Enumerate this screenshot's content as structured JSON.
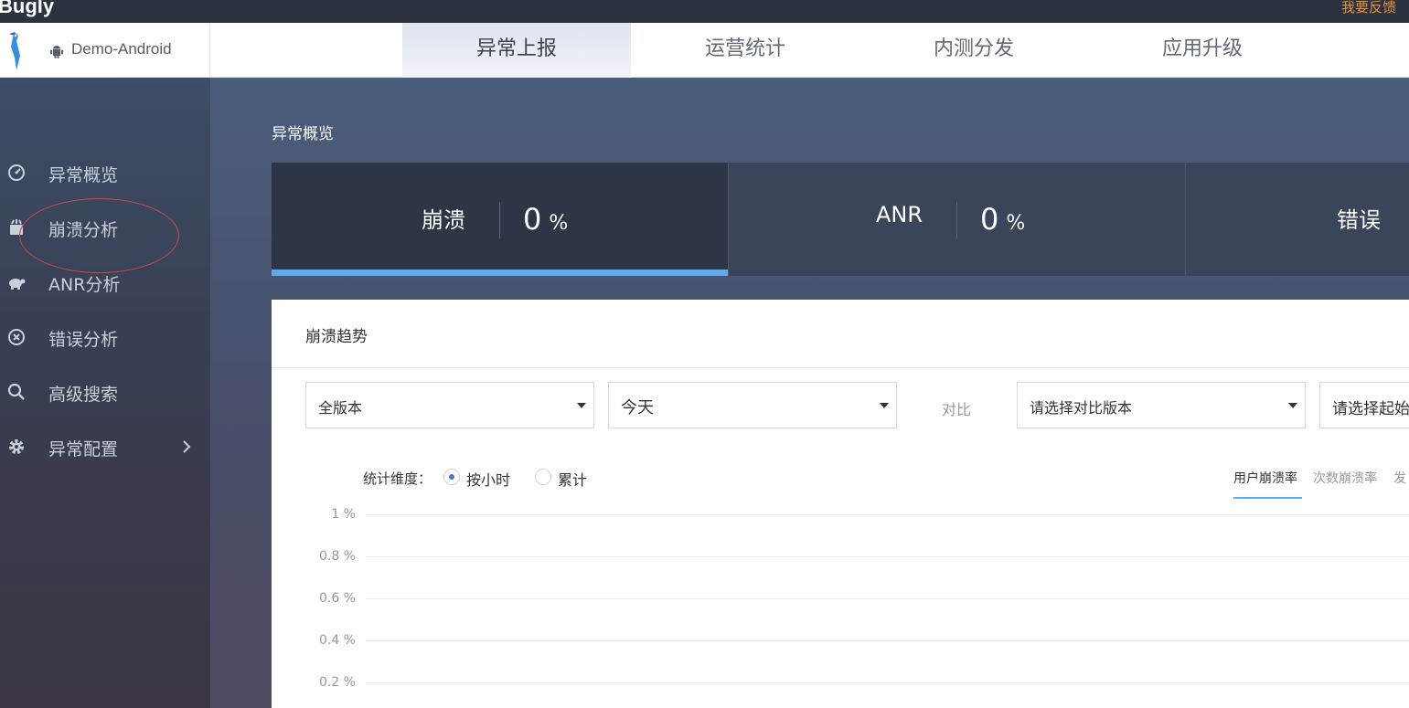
{
  "topbar": {
    "logo": "Bugly",
    "feedback": "我要反馈"
  },
  "header": {
    "app_name": "Demo-Android",
    "tabs": [
      {
        "label": "异常上报",
        "active": true
      },
      {
        "label": "运营统计",
        "active": false
      },
      {
        "label": "内测分发",
        "active": false
      },
      {
        "label": "应用升级",
        "active": false
      }
    ]
  },
  "sidebar": {
    "items": [
      {
        "label": "异常概览",
        "icon": "dashboard-icon"
      },
      {
        "label": "崩溃分析",
        "icon": "crash-icon"
      },
      {
        "label": "ANR分析",
        "icon": "turtle-icon"
      },
      {
        "label": "错误分析",
        "icon": "error-circle-icon"
      },
      {
        "label": "高级搜索",
        "icon": "search-icon"
      },
      {
        "label": "异常配置",
        "icon": "gear-icon",
        "has_arrow": true
      }
    ]
  },
  "overview": {
    "title": "异常概览",
    "cards": [
      {
        "name": "崩溃",
        "value": "0",
        "unit": "%",
        "active": true
      },
      {
        "name": "ANR",
        "value": "0",
        "unit": "%",
        "active": false
      },
      {
        "name": "错误",
        "value": "",
        "unit": "",
        "active": false
      }
    ]
  },
  "trend": {
    "title": "崩溃趋势",
    "version_select": "全版本",
    "date_select": "今天",
    "compare_label": "对比",
    "compare_version_placeholder": "请选择对比版本",
    "compare_date_placeholder": "请选择起始",
    "dimension_label": "统计维度：",
    "radios": [
      {
        "label": "按小时",
        "checked": true
      },
      {
        "label": "累计",
        "checked": false
      }
    ],
    "rate_tabs": [
      {
        "label": "用户崩溃率",
        "active": true
      },
      {
        "label": "次数崩溃率",
        "active": false
      },
      {
        "label": "发",
        "active": false
      }
    ],
    "y_ticks": [
      "1 %",
      "0.8 %",
      "0.6 %",
      "0.4 %",
      "0.2 %"
    ]
  },
  "colors": {
    "accent": "#5fa9ec",
    "feedback": "#e7913a",
    "annotation": "#c84a4a"
  }
}
